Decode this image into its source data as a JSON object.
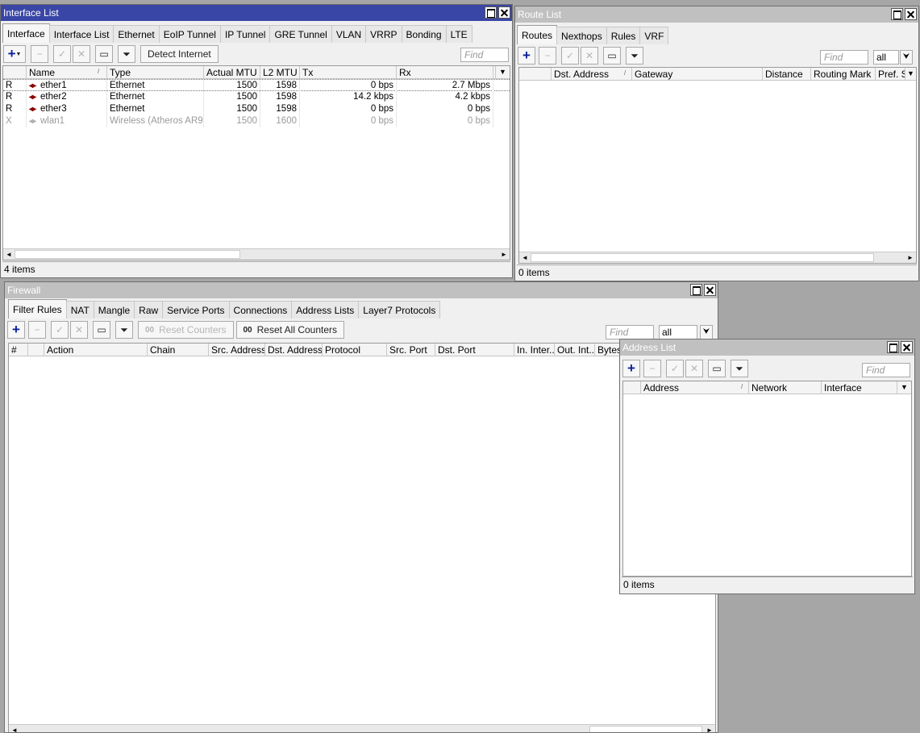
{
  "interface_window": {
    "title": "Interface List",
    "tabs": [
      "Interface",
      "Interface List",
      "Ethernet",
      "EoIP Tunnel",
      "IP Tunnel",
      "GRE Tunnel",
      "VLAN",
      "VRRP",
      "Bonding",
      "LTE"
    ],
    "detect_label": "Detect Internet",
    "find_placeholder": "Find",
    "columns": [
      "Name",
      "Type",
      "Actual MTU",
      "L2 MTU",
      "Tx",
      "Rx"
    ],
    "rows": [
      {
        "flag": "R",
        "name": "ether1",
        "type": "Ethernet",
        "mtu": "1500",
        "l2mtu": "1598",
        "tx": "0 bps",
        "rx": "2.7 Mbps"
      },
      {
        "flag": "R",
        "name": "ether2",
        "type": "Ethernet",
        "mtu": "1500",
        "l2mtu": "1598",
        "tx": "14.2 kbps",
        "rx": "4.2 kbps"
      },
      {
        "flag": "R",
        "name": "ether3",
        "type": "Ethernet",
        "mtu": "1500",
        "l2mtu": "1598",
        "tx": "0 bps",
        "rx": "0 bps"
      },
      {
        "flag": "X",
        "name": "wlan1",
        "type": "Wireless (Atheros AR9...",
        "mtu": "1500",
        "l2mtu": "1600",
        "tx": "0 bps",
        "rx": "0 bps"
      }
    ],
    "status": "4 items"
  },
  "route_window": {
    "title": "Route List",
    "tabs": [
      "Routes",
      "Nexthops",
      "Rules",
      "VRF"
    ],
    "find_placeholder": "Find",
    "filter_value": "all",
    "columns": [
      "Dst. Address",
      "Gateway",
      "Distance",
      "Routing Mark",
      "Pref. S"
    ],
    "status": "0 items"
  },
  "firewall_window": {
    "title": "Firewall",
    "tabs": [
      "Filter Rules",
      "NAT",
      "Mangle",
      "Raw",
      "Service Ports",
      "Connections",
      "Address Lists",
      "Layer7 Protocols"
    ],
    "reset_counters_label": "Reset Counters",
    "reset_all_label": "Reset All Counters",
    "counter_glyph": "00",
    "find_placeholder": "Find",
    "filter_value": "all",
    "columns": [
      "#",
      "Action",
      "Chain",
      "Src. Address",
      "Dst. Address",
      "Protocol",
      "Src. Port",
      "Dst. Port",
      "In. Inter...",
      "Out. Int...",
      "Bytes"
    ]
  },
  "address_window": {
    "title": "Address List",
    "find_placeholder": "Find",
    "columns": [
      "Address",
      "Network",
      "Interface"
    ],
    "status": "0 items"
  },
  "icons": {
    "add": "+",
    "remove": "−",
    "enable": "✓",
    "disable": "✕",
    "comment": "▭",
    "filter": "⏷",
    "scroll_left": "◄",
    "scroll_right": "►",
    "dropdown": "▼",
    "combo_arrow": "⮟",
    "eth": "◂▸"
  }
}
